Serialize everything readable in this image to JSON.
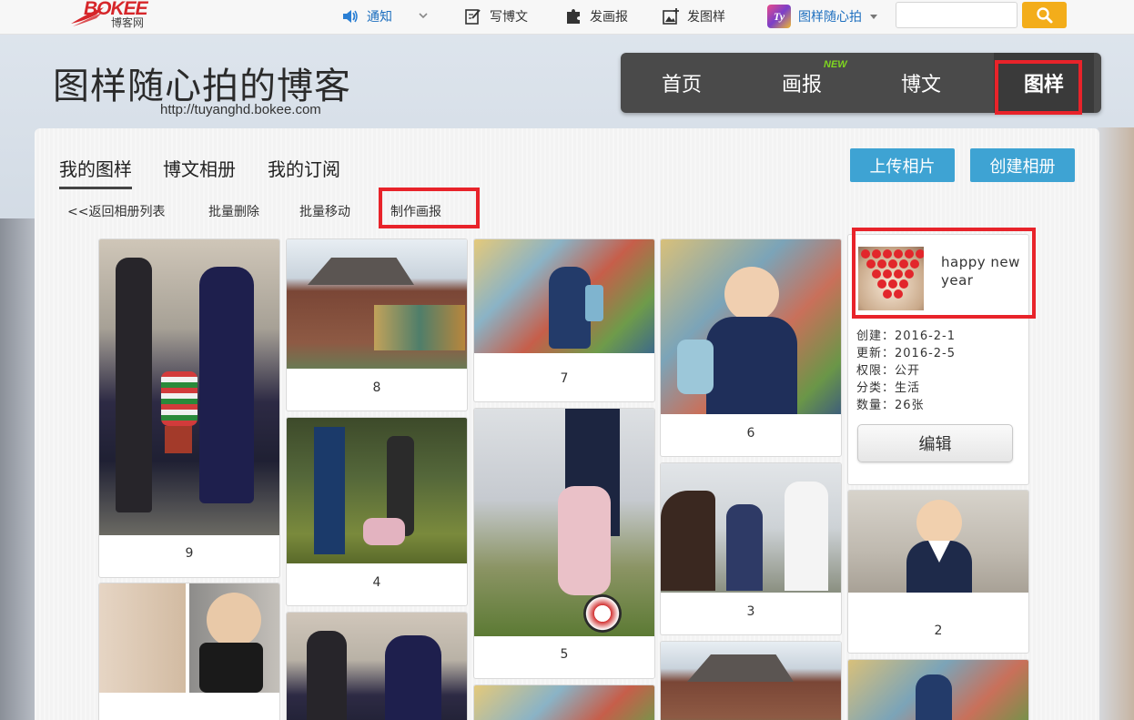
{
  "topbar": {
    "logo_text": "BOKEE",
    "logo_sub": "博客网",
    "notice": "通知",
    "write_blog": "写博文",
    "post_pictorial": "发画报",
    "post_sample": "发图样",
    "user_name": "图样随心拍",
    "search_placeholder": ""
  },
  "header": {
    "title": "图样随心拍的博客",
    "url": "http://tuyanghd.bokee.com"
  },
  "nav": {
    "items": [
      "首页",
      "画报",
      "博文",
      "图样"
    ],
    "new_badge": "NEW",
    "active_index": 3
  },
  "tabs": [
    "我的图样",
    "博文相册",
    "我的订阅"
  ],
  "actions": {
    "upload": "上传相片",
    "create_album": "创建相册"
  },
  "toolbar": {
    "back": "<<返回相册列表",
    "batch_delete": "批量删除",
    "batch_move": "批量移动",
    "make_pictorial": "制作画报"
  },
  "photos": [
    {
      "caption": "9"
    },
    {
      "caption": "8"
    },
    {
      "caption": "7"
    },
    {
      "caption": "6"
    },
    {
      "caption": "4"
    },
    {
      "caption": "5"
    },
    {
      "caption": "3"
    },
    {
      "caption": "2"
    },
    {
      "caption": ""
    },
    {
      "caption": ""
    },
    {
      "caption": ""
    },
    {
      "caption": ""
    },
    {
      "caption": ""
    }
  ],
  "album": {
    "name": "happy new year",
    "created": "创建：2016-2-1",
    "updated": "更新：2016-2-5",
    "permission": "权限：公开",
    "category": "分类：生活",
    "count": "数量：26张",
    "edit_label": "编辑"
  },
  "colors": {
    "accent_blue": "#3ea3d3",
    "highlight_red": "#e8232a",
    "nav_bg": "#4a4a4a",
    "search_btn": "#f3ad1a"
  }
}
